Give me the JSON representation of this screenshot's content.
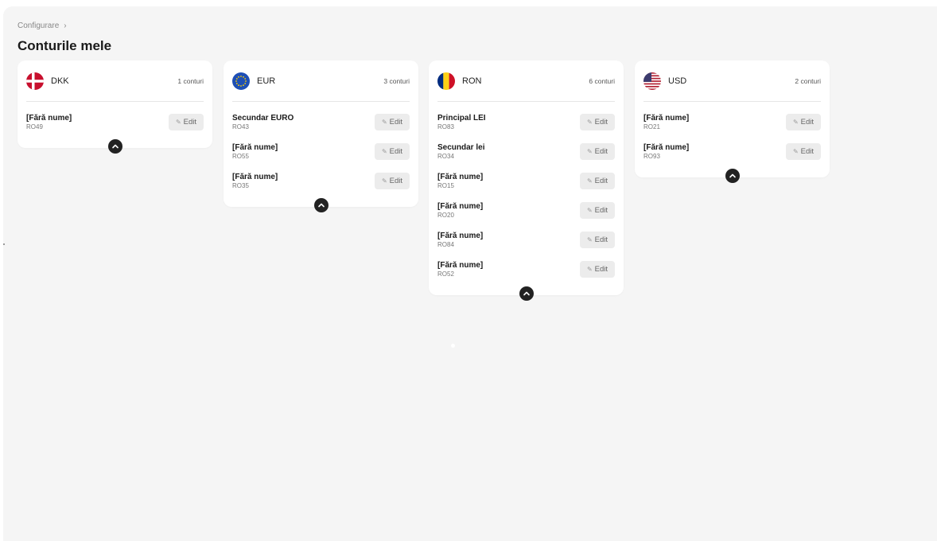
{
  "breadcrumb": {
    "label": "Configurare",
    "separator": "›"
  },
  "page": {
    "title": "Conturile mele"
  },
  "cards": [
    {
      "currency": "DKK",
      "count_label": "1 conturi",
      "flag_icon": "denmark-flag-icon",
      "accounts": [
        {
          "name": "[Fără nume]",
          "code": "RO49",
          "edit_label": "Edit"
        }
      ]
    },
    {
      "currency": "EUR",
      "count_label": "3 conturi",
      "flag_icon": "eu-flag-icon",
      "accounts": [
        {
          "name": "Secundar EURO",
          "code": "RO43",
          "edit_label": "Edit"
        },
        {
          "name": "[Fără nume]",
          "code": "RO55",
          "edit_label": "Edit"
        },
        {
          "name": "[Fără nume]",
          "code": "RO35",
          "edit_label": "Edit"
        }
      ]
    },
    {
      "currency": "RON",
      "count_label": "6 conturi",
      "flag_icon": "romania-flag-icon",
      "accounts": [
        {
          "name": "Principal LEI",
          "code": "RO83",
          "edit_label": "Edit"
        },
        {
          "name": "Secundar lei",
          "code": "RO34",
          "edit_label": "Edit"
        },
        {
          "name": "[Fără nume]",
          "code": "RO15",
          "edit_label": "Edit"
        },
        {
          "name": "[Fără nume]",
          "code": "RO20",
          "edit_label": "Edit"
        },
        {
          "name": "[Fără nume]",
          "code": "RO84",
          "edit_label": "Edit"
        },
        {
          "name": "[Fără nume]",
          "code": "RO52",
          "edit_label": "Edit"
        }
      ]
    },
    {
      "currency": "USD",
      "count_label": "2 conturi",
      "flag_icon": "usa-flag-icon",
      "accounts": [
        {
          "name": "[Fără nume]",
          "code": "RO21",
          "edit_label": "Edit"
        },
        {
          "name": "[Fără nume]",
          "code": "RO93",
          "edit_label": "Edit"
        }
      ]
    }
  ],
  "colors": {
    "background": "#f5f5f5",
    "card": "#ffffff",
    "edit_button": "#ececec",
    "collapse_button": "#222222"
  }
}
